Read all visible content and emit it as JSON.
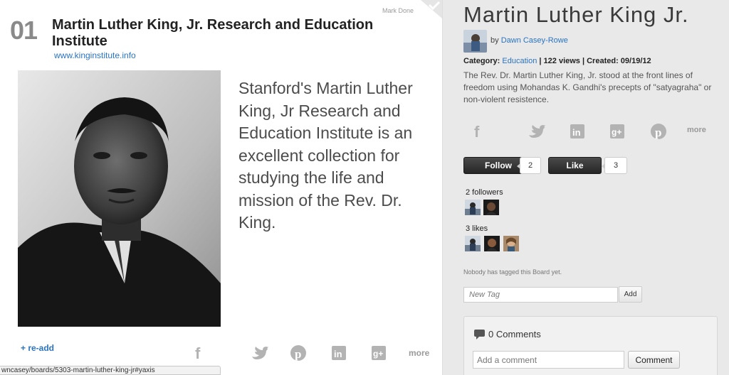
{
  "card": {
    "number": "01",
    "title": "Martin Luther King, Jr. Research and Education Institute",
    "url": "www.kinginstitute.info",
    "mark_done": "Mark Done",
    "quote": "Stanford's Martin Luther King, Jr Research and Education Institute is an excellent collection for studying the life and mission of the Rev. Dr. King.",
    "readd": "+ re-add",
    "share_icons": [
      "facebook-icon",
      "twitter-icon",
      "pinterest-icon",
      "linkedin-icon",
      "google-plus-icon"
    ],
    "share_more": "more"
  },
  "status_bar": {
    "url": "wncasey/boards/5303-martin-luther-king-jr#yaxis"
  },
  "panel": {
    "title": "Martin Luther King Jr.",
    "by_label": "by",
    "author": "Dawn Casey-Rowe",
    "category_label": "Category:",
    "category": "Education",
    "views": "| 122 views",
    "created": "| Created: 09/19/12",
    "description": "The Rev. Dr. Martin Luther King, Jr. stood at the front lines of freedom using Mohandas K. Gandhi's precepts of \"satyagraha\" or non-violent resistence.",
    "share_icons": [
      "facebook-icon",
      "twitter-icon",
      "linkedin-icon",
      "google-plus-icon",
      "pinterest-icon"
    ],
    "share_more": "more",
    "follow_label": "Follow",
    "follow_count": "2",
    "like_label": "Like",
    "like_count": "3",
    "followers_label": "2 followers",
    "likes_label": "3 likes",
    "no_tags": "Nobody has tagged this Board yet.",
    "tag_placeholder": "New Tag",
    "tag_add": "Add",
    "comments_label": "0 Comments",
    "comment_placeholder": "Add a comment",
    "comment_button": "Comment"
  },
  "colors": {
    "link": "#2a74c0",
    "dark_button": "#2e2e2e",
    "panel_bg": "#e9e9e9"
  }
}
